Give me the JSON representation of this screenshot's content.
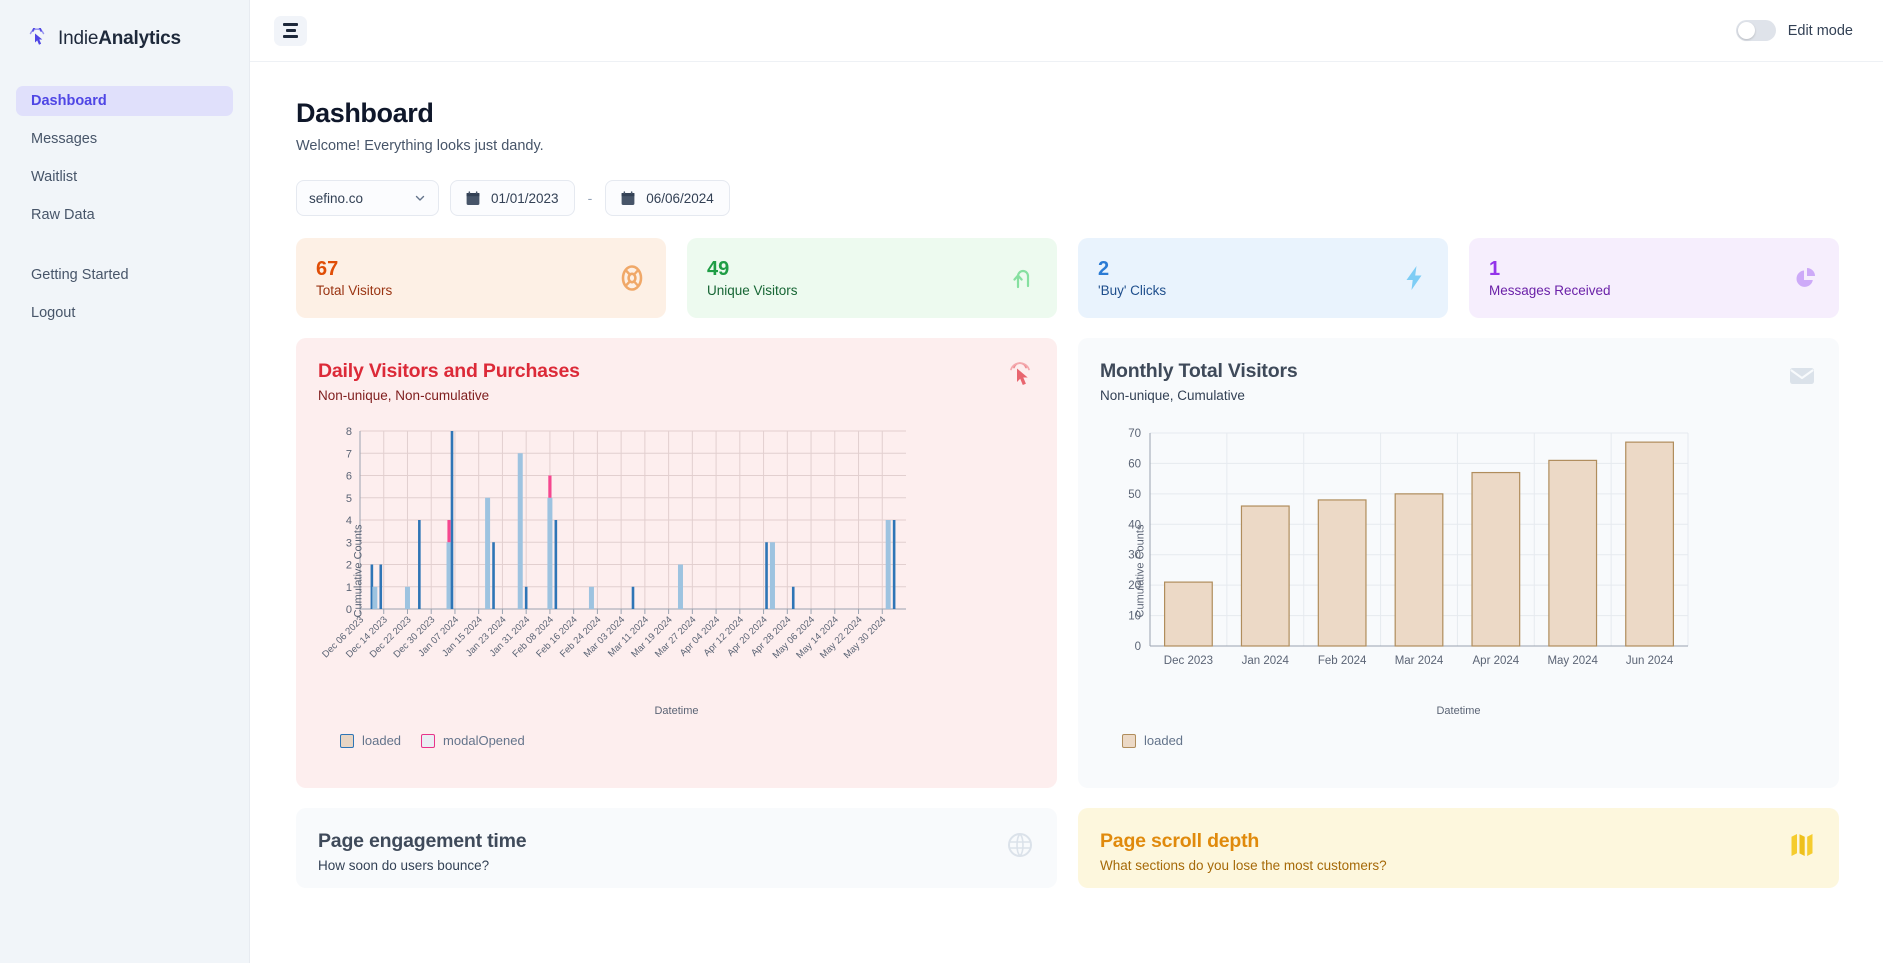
{
  "brand": {
    "name_light": "Indie",
    "name_bold": "Analytics",
    "logo_icon": "cursor-click-icon"
  },
  "sidebar": {
    "items": [
      {
        "label": "Dashboard",
        "active": true
      },
      {
        "label": "Messages",
        "active": false
      },
      {
        "label": "Waitlist",
        "active": false
      },
      {
        "label": "Raw Data",
        "active": false
      }
    ],
    "secondary": [
      {
        "label": "Getting Started"
      },
      {
        "label": "Logout"
      }
    ]
  },
  "topbar": {
    "menu_icon": "hamburger-icon",
    "edit_mode_label": "Edit mode",
    "edit_mode_on": false
  },
  "header": {
    "title": "Dashboard",
    "subtitle": "Welcome! Everything looks just dandy."
  },
  "filters": {
    "site_selected": "sefino.co",
    "start_date": "01/01/2023",
    "separator": "-",
    "end_date": "06/06/2024"
  },
  "kpis": [
    {
      "value": "67",
      "label": "Total Visitors",
      "icon": "lifebuoy-icon",
      "accent": "#e04e07"
    },
    {
      "value": "49",
      "label": "Unique Visitors",
      "icon": "arrow-up-turn-icon",
      "accent": "#1f9d45"
    },
    {
      "value": "2",
      "label": "'Buy' Clicks",
      "icon": "lightning-icon",
      "accent": "#2b7bd4"
    },
    {
      "value": "1",
      "label": "Messages Received",
      "icon": "pie-chart-icon",
      "accent": "#9333ea"
    }
  ],
  "cards": [
    {
      "title": "Daily Visitors and Purchases",
      "subtitle": "Non-unique, Non-cumulative",
      "icon": "cursor-click-icon"
    },
    {
      "title": "Monthly Total Visitors",
      "subtitle": "Non-unique, Cumulative",
      "icon": "envelope-icon"
    }
  ],
  "bottom_cards": [
    {
      "title": "Page engagement time",
      "subtitle": "How soon do users bounce?",
      "icon": "globe-icon"
    },
    {
      "title": "Page scroll depth",
      "subtitle": "What sections do you lose the most customers?",
      "icon": "map-icon"
    }
  ],
  "chart_data": [
    {
      "type": "bar",
      "title": "Daily Visitors and Purchases",
      "subtitle": "Non-unique, Non-cumulative",
      "xlabel": "Datetime",
      "ylabel": "Cumulative Counts",
      "ylim": [
        0,
        8
      ],
      "yticks": [
        0,
        1,
        2,
        3,
        4,
        5,
        6,
        7,
        8
      ],
      "grid": true,
      "legend": [
        {
          "name": "loaded",
          "fill": "#e8d5c4",
          "border": "#2e75b6"
        },
        {
          "name": "modalOpened",
          "fill": "#eaeef3",
          "border": "#e8348a"
        }
      ],
      "xticks": [
        "Dec 06 2023",
        "Dec 14 2023",
        "Dec 22 2023",
        "Dec 30 2023",
        "Jan 07 2024",
        "Jan 15 2024",
        "Jan 23 2024",
        "Jan 31 2024",
        "Feb 08 2024",
        "Feb 16 2024",
        "Feb 24 2024",
        "Mar 03 2024",
        "Mar 11 2024",
        "Mar 19 2024",
        "Mar 27 2024",
        "Apr 04 2024",
        "Apr 12 2024",
        "Apr 20 2024",
        "Apr 28 2024",
        "May 06 2024",
        "May 14 2024",
        "May 22 2024",
        "May 30 2024"
      ],
      "x_range_days": [
        0,
        184
      ],
      "series": [
        {
          "name": "loaded",
          "points": [
            {
              "day": 4,
              "value": 2
            },
            {
              "day": 5,
              "value": 1
            },
            {
              "day": 7,
              "value": 2
            },
            {
              "day": 16,
              "value": 1
            },
            {
              "day": 20,
              "value": 4
            },
            {
              "day": 30,
              "value": 3
            },
            {
              "day": 31,
              "value": 8
            },
            {
              "day": 43,
              "value": 5
            },
            {
              "day": 45,
              "value": 3
            },
            {
              "day": 54,
              "value": 7
            },
            {
              "day": 56,
              "value": 1
            },
            {
              "day": 64,
              "value": 5
            },
            {
              "day": 66,
              "value": 4
            },
            {
              "day": 78,
              "value": 1
            },
            {
              "day": 92,
              "value": 1
            },
            {
              "day": 108,
              "value": 2
            },
            {
              "day": 137,
              "value": 3
            },
            {
              "day": 139,
              "value": 3
            },
            {
              "day": 146,
              "value": 1
            },
            {
              "day": 178,
              "value": 4
            },
            {
              "day": 180,
              "value": 4
            }
          ]
        },
        {
          "name": "modalOpened",
          "points": [
            {
              "day": 30,
              "base": 3,
              "value": 4
            },
            {
              "day": 64,
              "base": 5,
              "value": 6
            }
          ]
        }
      ]
    },
    {
      "type": "bar",
      "title": "Monthly Total Visitors",
      "subtitle": "Non-unique, Cumulative",
      "xlabel": "Datetime",
      "ylabel": "Cumulative Counts",
      "ylim": [
        0,
        70
      ],
      "yticks": [
        0,
        10,
        20,
        30,
        40,
        50,
        60,
        70
      ],
      "grid": true,
      "categories": [
        "Dec 2023",
        "Jan 2024",
        "Feb 2024",
        "Mar 2024",
        "Apr 2024",
        "May 2024",
        "Jun 2024"
      ],
      "values": [
        21,
        46,
        48,
        50,
        57,
        61,
        67
      ],
      "legend": [
        {
          "name": "loaded",
          "fill": "#ecd9c6",
          "border": "#b08d5c"
        }
      ]
    }
  ]
}
